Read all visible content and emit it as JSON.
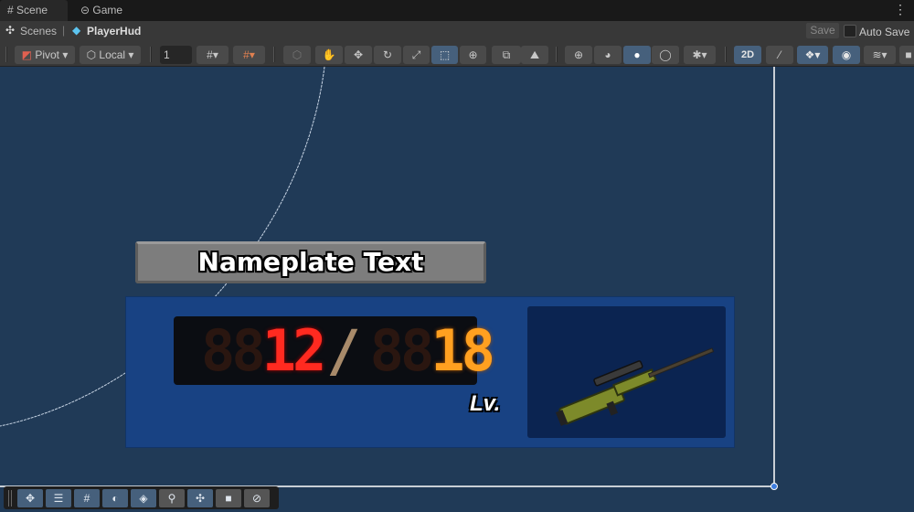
{
  "tabs": [
    {
      "label": "Scene",
      "icon": "grid-icon",
      "active": true
    },
    {
      "label": "Game",
      "icon": "gamepad-icon",
      "active": false
    }
  ],
  "breadcrumb": {
    "root": "Scenes",
    "current": "PlayerHud"
  },
  "header": {
    "save_label": "Save",
    "auto_save_label": "Auto Save",
    "auto_save_checked": false
  },
  "toolbar": {
    "pivot_label": "Pivot",
    "local_label": "Local",
    "grid_snap_value": "1",
    "mode_2d_label": "2D"
  },
  "hud": {
    "nameplate_text": "Nameplate Text",
    "ammo_ghost_1": "88",
    "ammo_current": "12",
    "separator": "/",
    "ammo_ghost_2": "88",
    "ammo_max": "18",
    "level_label": "Lv.",
    "weapon": "sniper-rifle"
  },
  "colors": {
    "scene_bg": "#203a57",
    "panel": "#184283",
    "ammo_current": "#ff2a20",
    "ammo_max": "#ffa020",
    "active_button": "#46607c"
  }
}
